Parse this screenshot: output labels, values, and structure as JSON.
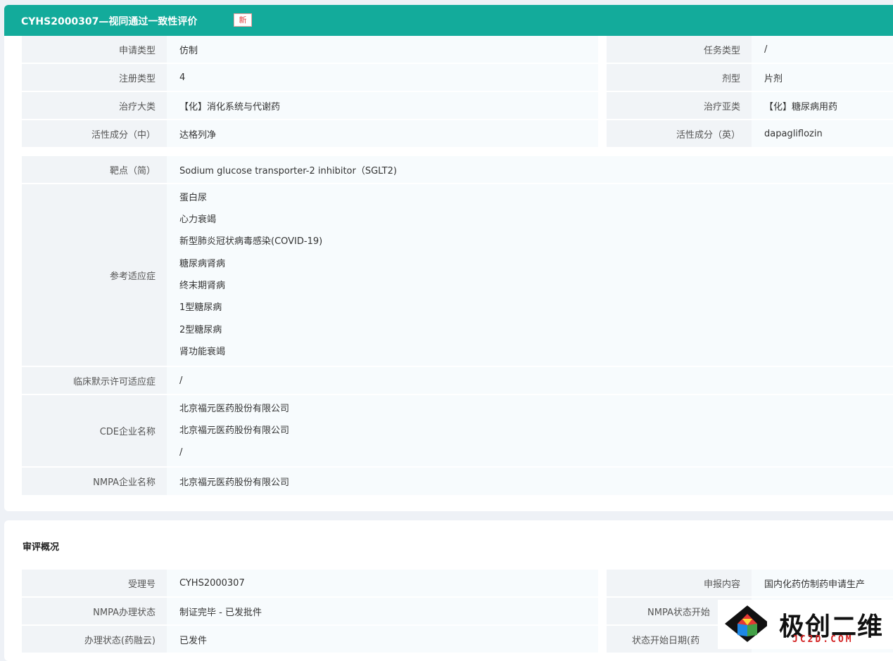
{
  "header": {
    "title": "CYHS2000307—视同通过一致性评价",
    "badge": "新"
  },
  "basic_grid": [
    {
      "l1": "申请类型",
      "v1": "仿制",
      "l2": "任务类型",
      "v2": "/"
    },
    {
      "l1": "注册类型",
      "v1": "4",
      "l2": "剂型",
      "v2": "片剂"
    },
    {
      "l1": "治疗大类",
      "v1": "【化】消化系统与代谢药",
      "l2": "治疗亚类",
      "v2": "【化】糖尿病用药"
    },
    {
      "l1": "活性成分（中）",
      "v1": "达格列净",
      "l2": "活性成分（英）",
      "v2": "dapagliflozin"
    }
  ],
  "target": {
    "label": "靶点（简）",
    "value": "Sodium glucose transporter-2 inhibitor（SGLT2)"
  },
  "indications": {
    "label": "参考适应症",
    "items": [
      "蛋白尿",
      "心力衰竭",
      "新型肺炎冠状病毒感染(COVID-19)",
      "糖尿病肾病",
      "终末期肾病",
      "1型糖尿病",
      "2型糖尿病",
      "肾功能衰竭"
    ]
  },
  "clinical": {
    "label": "临床默示许可适应症",
    "value": "/"
  },
  "cde": {
    "label": "CDE企业名称",
    "items": [
      "北京福元医药股份有限公司",
      "北京福元医药股份有限公司",
      "/"
    ]
  },
  "nmpa_company": {
    "label": "NMPA企业名称",
    "value": "北京福元医药股份有限公司"
  },
  "review": {
    "title": "审评概况",
    "rows": [
      {
        "l1": "受理号",
        "v1": "CYHS2000307",
        "l2": "申报内容",
        "v2": "国内化药仿制药申请生产"
      },
      {
        "l1": "NMPA办理状态",
        "v1": "制证完毕 - 已发批件",
        "l2": "NMPA状态开始",
        "v2": ""
      },
      {
        "l1": "办理状态(药融云)",
        "v1": "已发件",
        "l2": "状态开始日期(药",
        "v2": ""
      }
    ]
  },
  "watermark": {
    "cn": "极创二维",
    "en": "JC2D.COM"
  }
}
